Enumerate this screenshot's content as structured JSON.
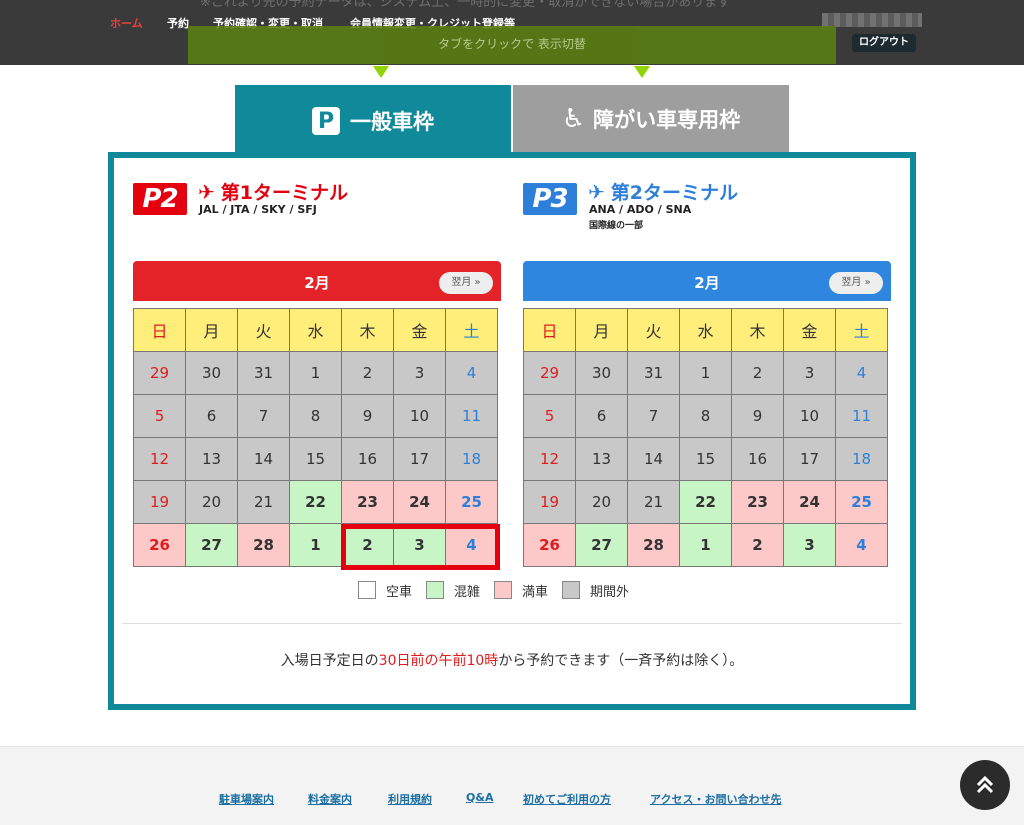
{
  "header": {
    "notice": "※これより先の予約データは、システム上、一時的に変更・取消ができない場合があります",
    "nav": [
      "ホーム",
      "予約",
      "予約確認・変更・取消",
      "会員情報変更・クレジット登録等"
    ],
    "logout_label": "ログアウト",
    "hint": "タブをクリックで 表示切替"
  },
  "tabs": {
    "general": {
      "icon": "parking-icon",
      "icon_glyph": "P",
      "label": "一般車枠"
    },
    "accessible": {
      "icon": "wheelchair-icon",
      "icon_glyph": "♿",
      "label": "障がい車専用枠"
    }
  },
  "terminals": [
    {
      "badge": "P2",
      "title": "第1ターミナル",
      "airlines": "JAL / JTA / SKY / SFJ",
      "note": "",
      "color": "#e4000f"
    },
    {
      "badge": "P3",
      "title": "第2ターミナル",
      "airlines": "ANA / ADO / SNA",
      "note": "国際線の一部",
      "color": "#2e7fd9"
    }
  ],
  "calendars": [
    {
      "month": "2月",
      "next_label": "翌月 »",
      "color": "#e42328",
      "weekdays": [
        "日",
        "月",
        "火",
        "水",
        "木",
        "金",
        "土"
      ],
      "weeks": [
        [
          {
            "d": "29",
            "s": "out"
          },
          {
            "d": "30",
            "s": "out"
          },
          {
            "d": "31",
            "s": "out"
          },
          {
            "d": "1",
            "s": "out"
          },
          {
            "d": "2",
            "s": "out"
          },
          {
            "d": "3",
            "s": "out"
          },
          {
            "d": "4",
            "s": "out"
          }
        ],
        [
          {
            "d": "5",
            "s": "out"
          },
          {
            "d": "6",
            "s": "out"
          },
          {
            "d": "7",
            "s": "out"
          },
          {
            "d": "8",
            "s": "out"
          },
          {
            "d": "9",
            "s": "out"
          },
          {
            "d": "10",
            "s": "out"
          },
          {
            "d": "11",
            "s": "out"
          }
        ],
        [
          {
            "d": "12",
            "s": "out"
          },
          {
            "d": "13",
            "s": "out"
          },
          {
            "d": "14",
            "s": "out"
          },
          {
            "d": "15",
            "s": "out"
          },
          {
            "d": "16",
            "s": "out"
          },
          {
            "d": "17",
            "s": "out"
          },
          {
            "d": "18",
            "s": "out"
          }
        ],
        [
          {
            "d": "19",
            "s": "out"
          },
          {
            "d": "20",
            "s": "out"
          },
          {
            "d": "21",
            "s": "out"
          },
          {
            "d": "22",
            "s": "busy"
          },
          {
            "d": "23",
            "s": "full"
          },
          {
            "d": "24",
            "s": "full"
          },
          {
            "d": "25",
            "s": "full"
          }
        ],
        [
          {
            "d": "26",
            "s": "full"
          },
          {
            "d": "27",
            "s": "busy"
          },
          {
            "d": "28",
            "s": "full"
          },
          {
            "d": "1",
            "s": "busy"
          },
          {
            "d": "2",
            "s": "busy"
          },
          {
            "d": "3",
            "s": "busy"
          },
          {
            "d": "4",
            "s": "full"
          }
        ]
      ]
    },
    {
      "month": "2月",
      "next_label": "翌月 »",
      "color": "#2e86de",
      "weekdays": [
        "日",
        "月",
        "火",
        "水",
        "木",
        "金",
        "土"
      ],
      "weeks": [
        [
          {
            "d": "29",
            "s": "out"
          },
          {
            "d": "30",
            "s": "out"
          },
          {
            "d": "31",
            "s": "out"
          },
          {
            "d": "1",
            "s": "out"
          },
          {
            "d": "2",
            "s": "out"
          },
          {
            "d": "3",
            "s": "out"
          },
          {
            "d": "4",
            "s": "out"
          }
        ],
        [
          {
            "d": "5",
            "s": "out"
          },
          {
            "d": "6",
            "s": "out"
          },
          {
            "d": "7",
            "s": "out"
          },
          {
            "d": "8",
            "s": "out"
          },
          {
            "d": "9",
            "s": "out"
          },
          {
            "d": "10",
            "s": "out"
          },
          {
            "d": "11",
            "s": "out"
          }
        ],
        [
          {
            "d": "12",
            "s": "out"
          },
          {
            "d": "13",
            "s": "out"
          },
          {
            "d": "14",
            "s": "out"
          },
          {
            "d": "15",
            "s": "out"
          },
          {
            "d": "16",
            "s": "out"
          },
          {
            "d": "17",
            "s": "out"
          },
          {
            "d": "18",
            "s": "out"
          }
        ],
        [
          {
            "d": "19",
            "s": "out"
          },
          {
            "d": "20",
            "s": "out"
          },
          {
            "d": "21",
            "s": "out"
          },
          {
            "d": "22",
            "s": "busy"
          },
          {
            "d": "23",
            "s": "full"
          },
          {
            "d": "24",
            "s": "full"
          },
          {
            "d": "25",
            "s": "full"
          }
        ],
        [
          {
            "d": "26",
            "s": "full"
          },
          {
            "d": "27",
            "s": "busy"
          },
          {
            "d": "28",
            "s": "full"
          },
          {
            "d": "1",
            "s": "busy"
          },
          {
            "d": "2",
            "s": "full"
          },
          {
            "d": "3",
            "s": "busy"
          },
          {
            "d": "4",
            "s": "full"
          }
        ]
      ]
    }
  ],
  "legend": [
    {
      "label": "空車",
      "color": "#ffffff"
    },
    {
      "label": "混雑",
      "color": "#c8f5c6"
    },
    {
      "label": "満車",
      "color": "#fcc8c8"
    },
    {
      "label": "期間外",
      "color": "#c8c8c8"
    }
  ],
  "reserve_note": {
    "pre": "入場日予定日の",
    "red": "30日前の午前10時",
    "post": "から予約できます（一斉予約は除く）。"
  },
  "footer_links": [
    "駐車場案内",
    "料金案内",
    "利用規約",
    "Q&A",
    "初めてご利用の方",
    "アクセス・お問い合わせ先"
  ],
  "scroll_top_icon": "double-chevron-up-icon"
}
